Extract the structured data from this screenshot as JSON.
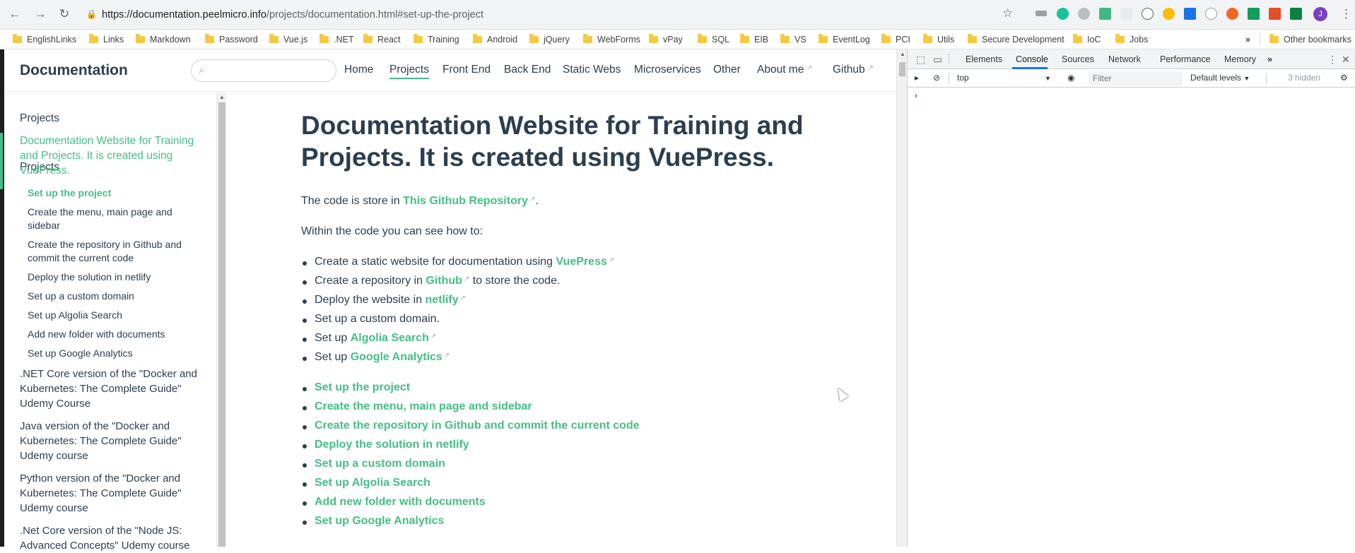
{
  "browser": {
    "url_host": "https://documentation.peelmicro.info",
    "url_path": "/projects/documentation.html#set-up-the-project",
    "avatar_initial": "J"
  },
  "bookmarks": [
    {
      "label": "EnglishLinks"
    },
    {
      "label": "Links"
    },
    {
      "label": "Markdown"
    },
    {
      "label": "Password"
    },
    {
      "label": "Vue.js"
    },
    {
      "label": ".NET"
    },
    {
      "label": "React"
    },
    {
      "label": "Training"
    },
    {
      "label": "Android"
    },
    {
      "label": "jQuery"
    },
    {
      "label": "WebForms"
    },
    {
      "label": "vPay"
    },
    {
      "label": "SQL"
    },
    {
      "label": "EIB"
    },
    {
      "label": "VS"
    },
    {
      "label": "EventLog"
    },
    {
      "label": "PCI"
    },
    {
      "label": "Utils"
    },
    {
      "label": "Secure Development"
    },
    {
      "label": "IoC"
    },
    {
      "label": "Jobs"
    }
  ],
  "bookmarks_more": "»",
  "other_bookmarks": "Other bookmarks",
  "site": {
    "name": "Documentation",
    "search_placeholder": "",
    "nav": [
      "Home",
      "Projects",
      "Front End",
      "Back End",
      "Static Webs",
      "Microservices",
      "Other",
      "About me",
      "Github"
    ]
  },
  "sidebar": {
    "heading": "Projects",
    "active_group": "Documentation Website for Training and Projects. It is created using VuePress.",
    "sub_items": [
      "Set up the project",
      "Create the menu, main page and sidebar",
      "Create the repository in Github and commit the current code",
      "Deploy the solution in netlify",
      "Set up a custom domain",
      "Set up Algolia Search",
      "Add new folder with documents",
      "Set up Google Analytics"
    ],
    "groups": [
      ".NET Core version of the \"Docker and Kubernetes: The Complete Guide\" Udemy Course",
      "Java version of the \"Docker and Kubernetes: The Complete Guide\" Udemy course",
      "Python version of the \"Docker and Kubernetes: The Complete Guide\" Udemy course",
      ".Net Core version of the \"Node JS: Advanced Concepts\" Udemy course"
    ]
  },
  "content": {
    "title": "Documentation Website for Training and Projects. It is created using VuePress.",
    "repo_prefix": "The code is store in ",
    "repo_link": "This Github Repository",
    "repo_suffix": ".",
    "intro": "Within the code you can see how to:",
    "bullets": [
      {
        "pre": "Create a static website for documentation using ",
        "link": "VuePress",
        "post": ""
      },
      {
        "pre": "Create a repository in ",
        "link": "Github",
        "post": " to store the code."
      },
      {
        "pre": "Deploy the website in ",
        "link": "netlify",
        "post": ""
      },
      {
        "pre": "Set up a custom domain.",
        "link": "",
        "post": ""
      },
      {
        "pre": "Set up ",
        "link": "Algolia Search",
        "post": ""
      },
      {
        "pre": "Set up ",
        "link": "Google Analytics",
        "post": ""
      }
    ],
    "toc": [
      "Set up the project",
      "Create the menu, main page and sidebar",
      "Create the repository in Github and commit the current code",
      "Deploy the solution in netlify",
      "Set up a custom domain",
      "Set up Algolia Search",
      "Add new folder with documents",
      "Set up Google Analytics"
    ]
  },
  "devtools": {
    "tabs": [
      "Elements",
      "Console",
      "Sources",
      "Network",
      "Performance",
      "Memory"
    ],
    "more_tabs": "»",
    "context": "top",
    "filter_placeholder": "Filter",
    "levels": "Default levels",
    "hidden": "3 hidden",
    "prompt": "›"
  },
  "colors": {
    "accent": "#46bd87",
    "text": "#2c3e50",
    "devtools_active": "#1a73e8"
  }
}
